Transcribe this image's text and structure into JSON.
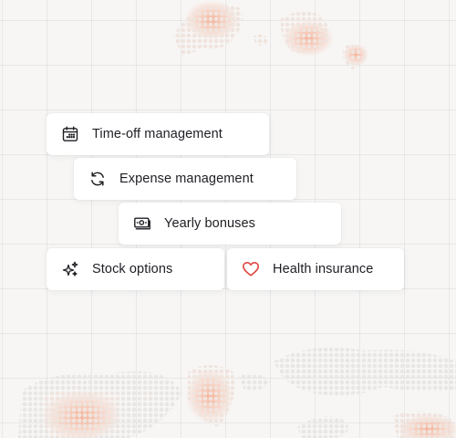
{
  "benefits": [
    {
      "id": "timeoff",
      "label": "Time-off management",
      "icon": "calendar-icon"
    },
    {
      "id": "expense",
      "label": "Expense management",
      "icon": "refresh-icon"
    },
    {
      "id": "bonuses",
      "label": "Yearly bonuses",
      "icon": "banknote-icon"
    },
    {
      "id": "stock",
      "label": "Stock options",
      "icon": "sparkles-icon"
    },
    {
      "id": "health",
      "label": "Health insurance",
      "icon": "heart-icon"
    }
  ],
  "colors": {
    "background": "#f7f6f5",
    "card": "#ffffff",
    "text": "#1e1e24",
    "icon": "#1e1e24",
    "heart": "#e0473f",
    "map_dot": "#efe3dd",
    "map_glow": "#f3a98e"
  }
}
